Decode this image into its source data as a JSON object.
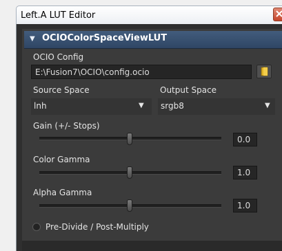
{
  "window": {
    "title": "Left.A LUT Editor"
  },
  "tool": {
    "header": "OCIOColorSpaceViewLUT"
  },
  "ocio_config": {
    "label": "OCIO Config",
    "path": "E:\\Fusion7\\OCIO\\config.ocio"
  },
  "source_space": {
    "label": "Source Space",
    "value": "lnh"
  },
  "output_space": {
    "label": "Output Space",
    "value": "srgb8"
  },
  "gain": {
    "label": "Gain (+/- Stops)",
    "value": "0.0"
  },
  "color_gamma": {
    "label": "Color Gamma",
    "value": "1.0"
  },
  "alpha_gamma": {
    "label": "Alpha Gamma",
    "value": "1.0"
  },
  "predivide": {
    "label": "Pre-Divide / Post-Multiply"
  }
}
